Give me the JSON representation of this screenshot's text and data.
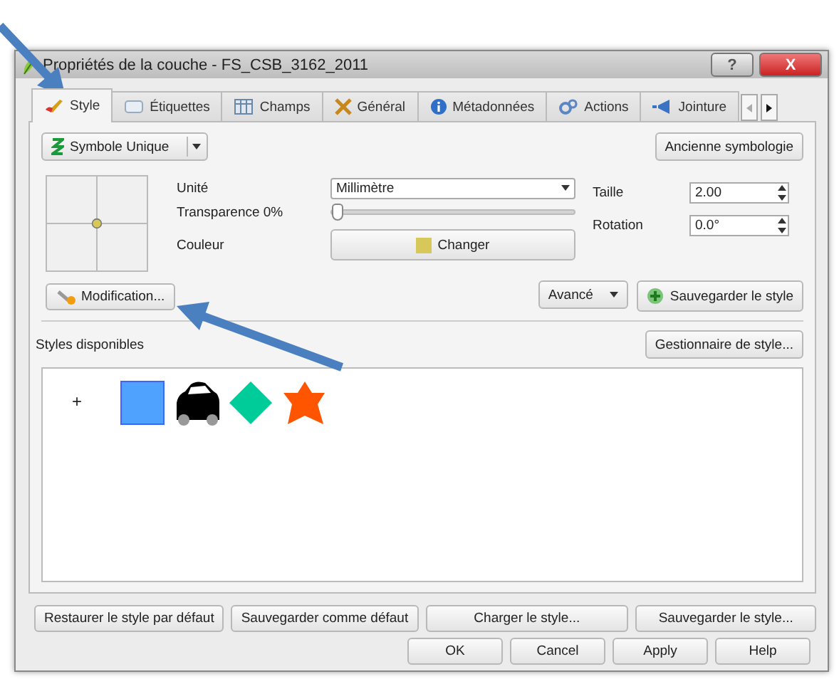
{
  "window": {
    "title": "Propriétés de la couche - FS_CSB_3162_2011",
    "help_button": "?",
    "close_button": "X"
  },
  "tabs": [
    {
      "label": "Style",
      "selected": true
    },
    {
      "label": "Étiquettes",
      "selected": false
    },
    {
      "label": "Champs",
      "selected": false
    },
    {
      "label": "Général",
      "selected": false
    },
    {
      "label": "Métadonnées",
      "selected": false
    },
    {
      "label": "Actions",
      "selected": false
    },
    {
      "label": "Jointure",
      "selected": false
    }
  ],
  "renderer": {
    "type": "Symbole Unique",
    "legacy_button": "Ancienne symbologie"
  },
  "symbol": {
    "unit_label": "Unité",
    "unit": "Millimètre",
    "transparency_label": "Transparence 0%",
    "transparency": {
      "level": 0
    },
    "color_label": "Couleur",
    "color_button": "Changer",
    "color": "#d8c85a",
    "size_label": "Taille",
    "size": "2.00",
    "rotation_label": "Rotation",
    "rotation": "0.0°"
  },
  "modify_button": "Modification...",
  "advanced_button": "Avancé",
  "save_style_button": "Sauvegarder le style",
  "styles": {
    "label": "Styles disponibles",
    "manager_button": "Gestionnaire de style...",
    "items": [
      {
        "kind": "add",
        "label": "+"
      },
      {
        "kind": "square",
        "color": "#4fa3ff"
      },
      {
        "kind": "car",
        "color": "#000000"
      },
      {
        "kind": "diamond",
        "color": "#00cc99"
      },
      {
        "kind": "star",
        "color": "#ff5500"
      }
    ]
  },
  "footer_buttons": [
    "Restaurer le style par défaut",
    "Sauvegarder comme défaut",
    "Charger le style...",
    "Sauvegarder le style..."
  ],
  "dialog_buttons": [
    "OK",
    "Cancel",
    "Apply",
    "Help"
  ]
}
